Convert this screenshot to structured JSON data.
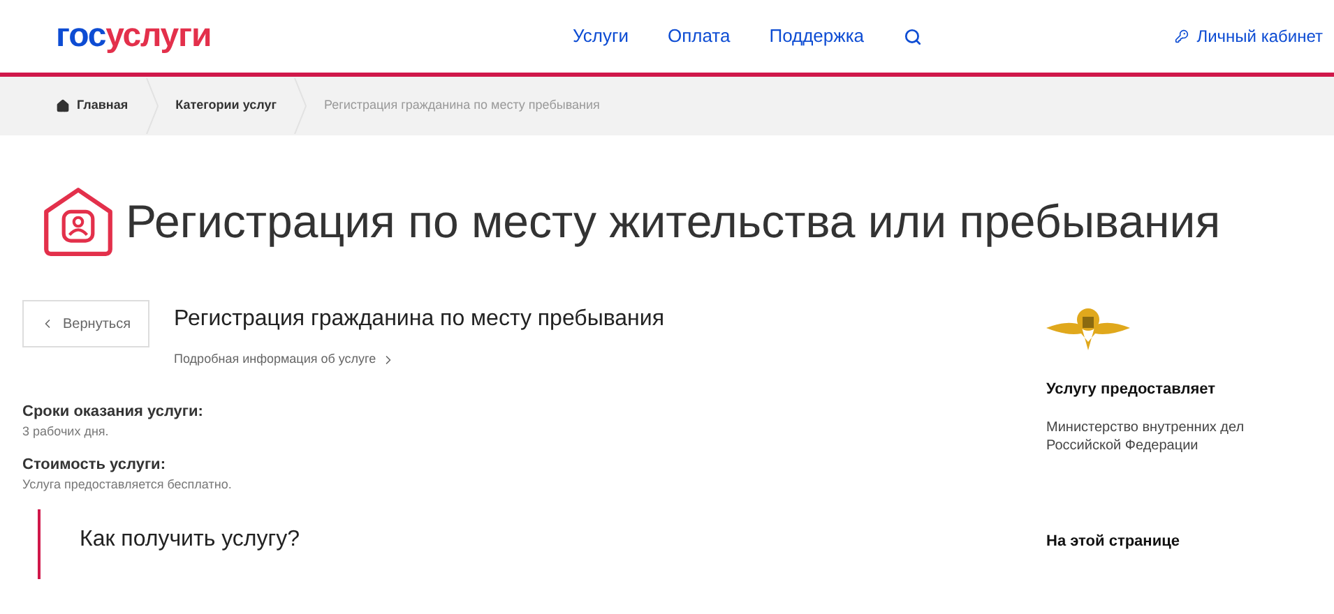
{
  "logo": {
    "part_1": "гос",
    "part_2": "услуги"
  },
  "nav": [
    {
      "label": "Услуги"
    },
    {
      "label": "Оплата"
    },
    {
      "label": "Поддержка"
    }
  ],
  "account_link": "Личный кабинет",
  "breadcrumbs": [
    {
      "label": "Главная",
      "kind": "home"
    },
    {
      "label": "Категории услуг",
      "kind": "link"
    },
    {
      "label": "Регистрация гражданина по месту пребывания",
      "kind": "current"
    }
  ],
  "page_title": "Регистрация по месту жительства или пребывания",
  "back_button": "Вернуться",
  "service_title": "Регистрация гражданина по месту пребывания",
  "details_link": "Подробная информация об услуге",
  "facts": [
    {
      "label": "Сроки оказания услуги:",
      "value": "3 рабочих дня."
    },
    {
      "label": "Стоимость услуги:",
      "value": "Услуга предоставляется бесплатно."
    }
  ],
  "how_to_heading": "Как получить услугу?",
  "sidebar": {
    "provider_heading": "Услугу предоставляет",
    "provider_name": "Министерство внутренних дел Российской Федерации",
    "on_page_heading": "На этой странице"
  }
}
